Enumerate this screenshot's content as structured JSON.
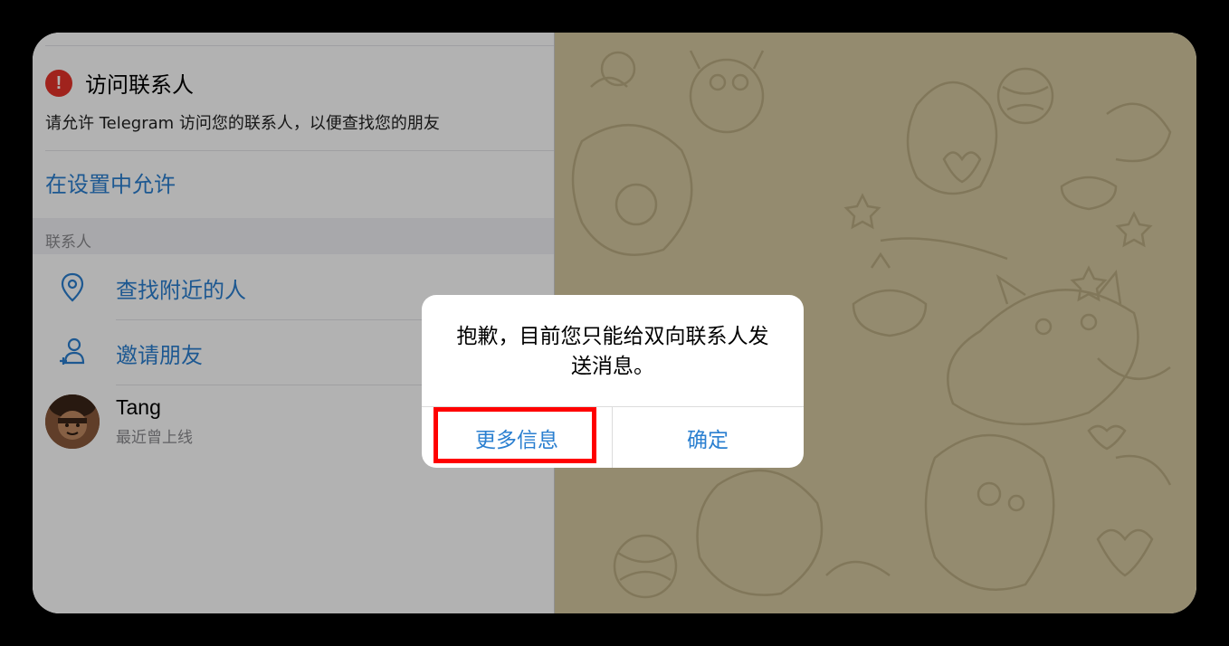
{
  "permission": {
    "title": "访问联系人",
    "description": "请允许 Telegram 访问您的联系人，以便查找您的朋友",
    "allow_link": "在设置中允许"
  },
  "section": {
    "label": "联系人"
  },
  "menu": [
    {
      "label": "查找附近的人",
      "icon": "location-pin-icon"
    },
    {
      "label": "邀请朋友",
      "icon": "add-person-icon"
    }
  ],
  "contact": {
    "name": "Tang",
    "status": "最近曾上线"
  },
  "alert": {
    "message": "抱歉，目前您只能给双向联系人发送消息。",
    "more_info_label": "更多信息",
    "ok_label": "确定"
  },
  "colors": {
    "accent": "#2a7fd0",
    "warning": "#e5332a",
    "chat_background": "#d4c79f",
    "highlight": "#ff0000"
  }
}
